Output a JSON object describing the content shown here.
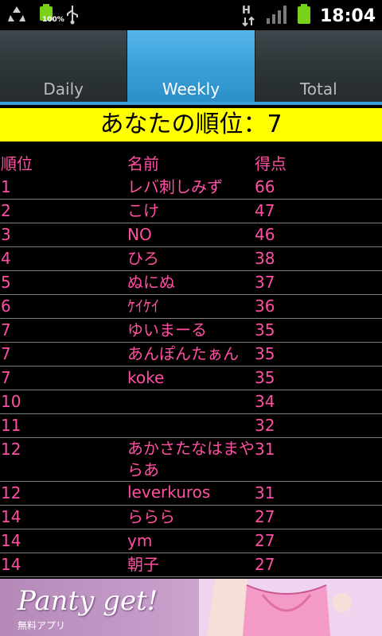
{
  "status_bar": {
    "battery_percent": "100%",
    "network": "H",
    "time": "18:04",
    "icons": [
      "recycle-icon",
      "battery-icon",
      "usb-icon",
      "hspa-icon",
      "signal-icon",
      "battery-full-icon"
    ]
  },
  "tabs": [
    {
      "label": "Daily",
      "active": false
    },
    {
      "label": "Weekly",
      "active": true
    },
    {
      "label": "Total",
      "active": false
    }
  ],
  "rank_banner": "あなたの順位：7",
  "table": {
    "headers": {
      "rank": "順位",
      "name": "名前",
      "score": "得点"
    },
    "rows": [
      {
        "rank": "1",
        "name": "レバ刺しみず",
        "score": "66"
      },
      {
        "rank": "2",
        "name": "こけ",
        "score": "47"
      },
      {
        "rank": "3",
        "name": "NO",
        "score": "46"
      },
      {
        "rank": "4",
        "name": "ひろ",
        "score": "38"
      },
      {
        "rank": "5",
        "name": "ぬにぬ",
        "score": "37"
      },
      {
        "rank": "6",
        "name": "ｹｲｹｲ",
        "score": "36"
      },
      {
        "rank": "7",
        "name": "ゆいまーる",
        "score": "35"
      },
      {
        "rank": "7",
        "name": "あんぽんたぁん",
        "score": "35"
      },
      {
        "rank": "7",
        "name": "koke",
        "score": "35"
      },
      {
        "rank": "10",
        "name": "",
        "score": "34"
      },
      {
        "rank": "11",
        "name": "",
        "score": "32"
      },
      {
        "rank": "12",
        "name": "あかさたなはまやらあ",
        "score": "31"
      },
      {
        "rank": "12",
        "name": "leverkuros",
        "score": "31"
      },
      {
        "rank": "14",
        "name": "ららら",
        "score": "27"
      },
      {
        "rank": "14",
        "name": "ym",
        "score": "27"
      },
      {
        "rank": "14",
        "name": "朝子",
        "score": "27"
      }
    ]
  },
  "ad": {
    "title": "Panty get!",
    "subtitle": "無料アプリ"
  },
  "colors": {
    "accent": "#3a9fd9",
    "banner": "#ffff00",
    "text_pink": "#ff4fa3",
    "row_divider": "#7f7f7f"
  }
}
